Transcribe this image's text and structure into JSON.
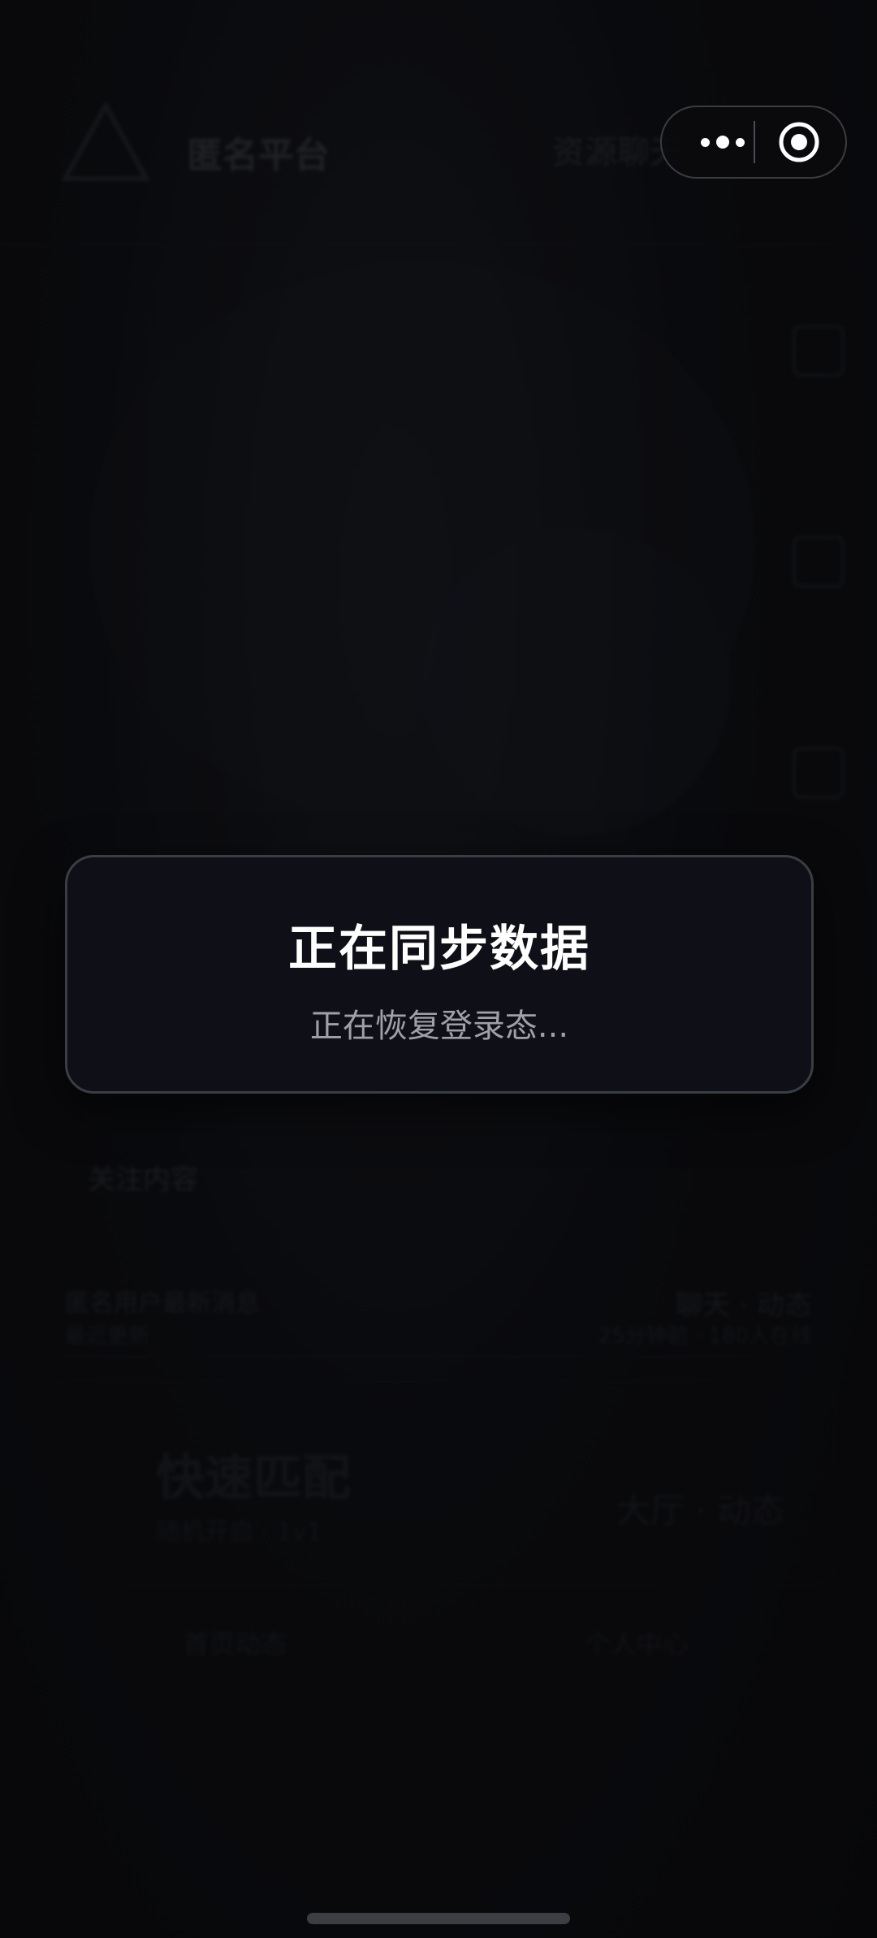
{
  "background": {
    "app_title": "匿名平台",
    "category_label": "资源聊天",
    "section_title": "关注内容",
    "row": {
      "left_line1": "匿名用户最新消息",
      "left_line2": "最近更新",
      "right_line1": "聊天 · 动态",
      "right_line2": "25分钟前 · 180人在线"
    },
    "match_card": {
      "title": "快速匹配",
      "subtitle": "随机开启 · 1v1",
      "right_label": "大厅 · 动态"
    },
    "tabs": [
      "首页动态",
      "个人中心"
    ]
  },
  "capsule": {
    "more_icon": "more-dots-icon",
    "close_icon": "close-target-icon"
  },
  "modal": {
    "title": "正在同步数据",
    "message": "正在恢复登录态..."
  },
  "colors": {
    "modal_bg": "#0f0f17",
    "modal_border": "#3b3d44",
    "title": "#ffffff",
    "message": "#9fa1a8"
  }
}
